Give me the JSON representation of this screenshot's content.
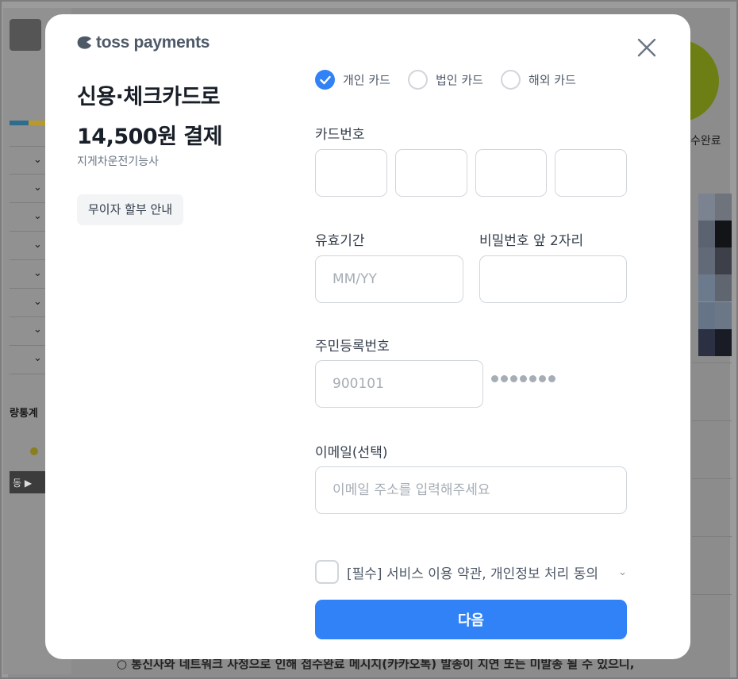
{
  "background": {
    "left_stat_label": "량통계",
    "left_button_label": "동 ▶",
    "right_status": "수완료",
    "bottom_notice": "○ 통신사와 네트워크 사정으로 인해 접수완료 메시지(카카오톡) 발송이 지연 또는 미발송 될 수 있으니,"
  },
  "modal": {
    "logo_text": "toss payments",
    "title_line1": "신용·체크카드로",
    "title_line2": "14,500원 결제",
    "merchant": "지게차운전기능사",
    "installment_button": "무이자 할부 안내",
    "card_types": [
      {
        "label": "개인 카드",
        "checked": true
      },
      {
        "label": "법인 카드",
        "checked": false
      },
      {
        "label": "해외 카드",
        "checked": false
      }
    ],
    "card_number_label": "카드번호",
    "expiry_label": "유효기간",
    "expiry_placeholder": "MM/YY",
    "password_label": "비밀번호 앞 2자리",
    "resident_label": "주민등록번호",
    "resident_placeholder": "900101",
    "email_label": "이메일(선택)",
    "email_placeholder": "이메일 주소를 입력해주세요",
    "agreement_text": "[필수] 서비스 이용 약관, 개인정보 처리 동의",
    "next_button": "다음"
  },
  "colors": {
    "primary": "#3182f6",
    "text_dark": "#191f28",
    "text_muted": "#6b7684",
    "border": "#d1d6db"
  }
}
